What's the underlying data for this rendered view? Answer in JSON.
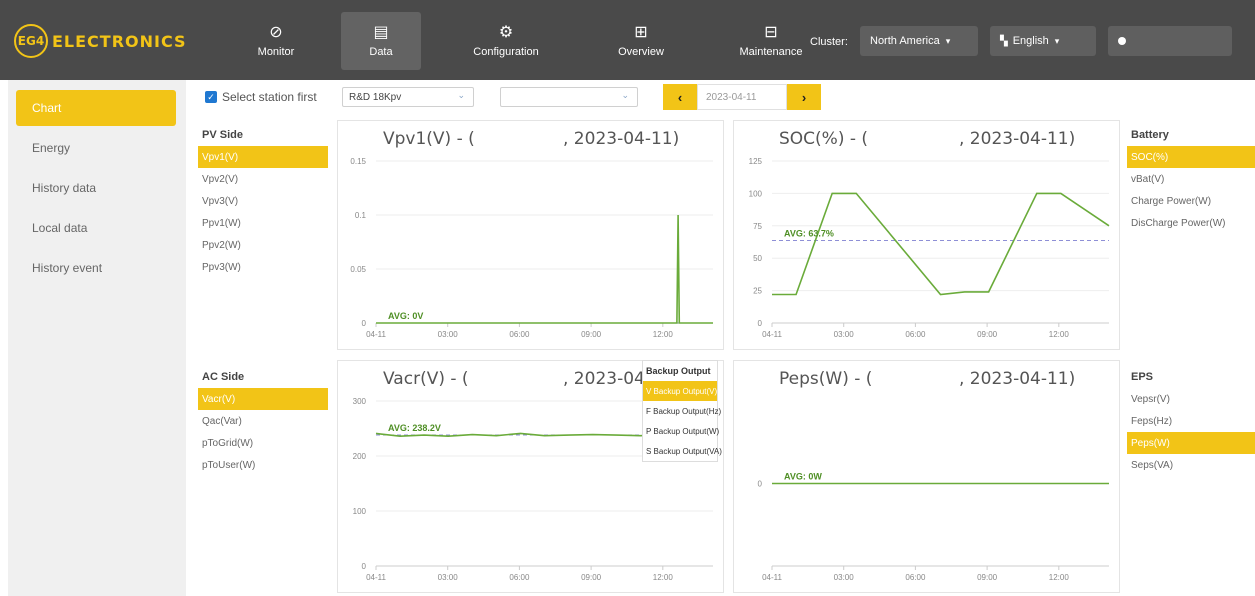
{
  "header": {
    "logo_badge": "EG4",
    "logo_text": "ELECTRONICS",
    "nav": [
      {
        "label": "Monitor",
        "icon": "⊘"
      },
      {
        "label": "Data",
        "icon": "▤"
      },
      {
        "label": "Configuration",
        "icon": "⚙"
      },
      {
        "label": "Overview",
        "icon": "⊞"
      },
      {
        "label": "Maintenance",
        "icon": "⊟"
      }
    ],
    "cluster_label": "Cluster:",
    "cluster_value": "North America",
    "language_value": "English",
    "user_icon": "user-icon"
  },
  "sidebar": {
    "items": [
      {
        "label": "Chart"
      },
      {
        "label": "Energy"
      },
      {
        "label": "History data"
      },
      {
        "label": "Local data"
      },
      {
        "label": "History event"
      }
    ]
  },
  "toolbar": {
    "select_station_label": "Select station first",
    "station_value": "R&D 18Kpv",
    "device_value": "",
    "date_value": "2023-04-11",
    "prev_icon": "‹",
    "next_icon": "›"
  },
  "lists": {
    "pv": {
      "header": "PV Side",
      "items": [
        "Vpv1(V)",
        "Vpv2(V)",
        "Vpv3(V)",
        "Ppv1(W)",
        "Ppv2(W)",
        "Ppv3(W)"
      ]
    },
    "battery": {
      "header": "Battery",
      "items": [
        "SOC(%)",
        "vBat(V)",
        "Charge Power(W)",
        "DisCharge Power(W)"
      ]
    },
    "ac": {
      "header": "AC Side",
      "items": [
        "Vacr(V)",
        "Qac(Var)",
        "pToGrid(W)",
        "pToUser(W)"
      ]
    },
    "eps": {
      "header": "EPS",
      "items": [
        "Vepsr(V)",
        "Feps(Hz)",
        "Peps(W)",
        "Seps(VA)"
      ]
    }
  },
  "backup_popup": {
    "title": "Backup Output",
    "items": [
      "V Backup Output(V)",
      "F Backup Output(Hz)",
      "P Backup Output(W)",
      "S Backup Output(VA)"
    ]
  },
  "chart_data": [
    {
      "type": "line",
      "title": "Vpv1(V) - (",
      "date_text": ", 2023-04-11)",
      "x_ticks": [
        "04-11",
        "03:00",
        "06:00",
        "09:00",
        "12:00"
      ],
      "y_ticks": [
        "0",
        "0.05",
        "0.1",
        "0.15"
      ],
      "ylim": [
        0,
        0.15
      ],
      "xlim": [
        0,
        14
      ],
      "avg_label": "AVG: 0V",
      "avg_value": 0,
      "color": "#6aab3a",
      "series": [
        {
          "x": [
            0,
            12.5,
            12.55,
            12.6,
            12.65,
            14
          ],
          "y": [
            0,
            0,
            0.1,
            0,
            0,
            0
          ]
        }
      ]
    },
    {
      "type": "line",
      "title": "SOC(%) - (",
      "date_text": ", 2023-04-11)",
      "x_ticks": [
        "04-11",
        "03:00",
        "06:00",
        "09:00",
        "12:00"
      ],
      "y_ticks": [
        "0",
        "25",
        "50",
        "75",
        "100",
        "125"
      ],
      "ylim": [
        0,
        125
      ],
      "xlim": [
        0,
        14
      ],
      "avg_label": "AVG: 63.7%",
      "avg_value": 63.7,
      "color": "#6aab3a",
      "series": [
        {
          "x": [
            0,
            1,
            2.5,
            3.5,
            7,
            8,
            9,
            11,
            12,
            14
          ],
          "y": [
            22,
            22,
            100,
            100,
            22,
            24,
            24,
            100,
            100,
            75
          ]
        }
      ]
    },
    {
      "type": "line",
      "title": "Vacr(V) - (",
      "date_text": ", 2023-04-11)",
      "x_ticks": [
        "04-11",
        "03:00",
        "06:00",
        "09:00",
        "12:00"
      ],
      "y_ticks": [
        "0",
        "100",
        "200",
        "300"
      ],
      "ylim": [
        0,
        300
      ],
      "xlim": [
        0,
        14
      ],
      "avg_label": "AVG: 238.2V",
      "avg_value": 238.2,
      "color": "#6aab3a",
      "series": [
        {
          "x": [
            0,
            1,
            2,
            3,
            4,
            5,
            6,
            7,
            8,
            9,
            10,
            11,
            12,
            13,
            14
          ],
          "y": [
            241,
            236,
            238,
            236,
            239,
            237,
            241,
            237,
            238,
            239,
            238,
            237,
            240,
            236,
            241
          ]
        }
      ]
    },
    {
      "type": "line",
      "title": "Peps(W) - (",
      "date_text": ", 2023-04-11)",
      "x_ticks": [
        "04-11",
        "03:00",
        "06:00",
        "09:00",
        "12:00"
      ],
      "y_ticks": [
        "0"
      ],
      "ylim": [
        -1,
        1
      ],
      "xlim": [
        0,
        14
      ],
      "avg_label": "AVG: 0W",
      "avg_value": 0,
      "color": "#6aab3a",
      "series": [
        {
          "x": [
            0,
            14
          ],
          "y": [
            0,
            0
          ]
        }
      ]
    }
  ]
}
